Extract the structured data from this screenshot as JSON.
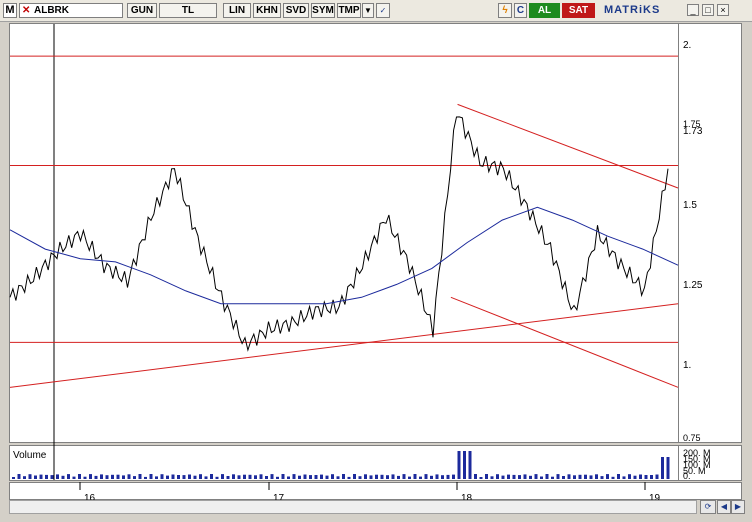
{
  "toolbar": {
    "logo": "M",
    "symbol": "ALBRK",
    "buttons": [
      "GUN",
      "TL",
      "LIN",
      "KHN",
      "SVD",
      "SYM",
      "TMP"
    ],
    "refresh_label": "C",
    "buy_label": "AL",
    "sell_label": "SAT",
    "brand": "MATRiKS",
    "window_buttons": [
      "_",
      "□",
      "×"
    ]
  },
  "colors": {
    "price_line": "#000000",
    "moving_average": "#1c2a9c",
    "trend_lines": "#d42020",
    "volume_bars": "#1c2a9c",
    "buy": "#1e8b1e",
    "sell": "#c01818"
  },
  "chart": {
    "y_ticks": [
      "2.",
      "1.75",
      "1.73",
      "1.5",
      "1.25",
      "1.",
      "0.75"
    ],
    "x_ticks": [
      "16",
      "17",
      "18",
      "19"
    ],
    "volume_label": "Volume",
    "volume_ticks": [
      "200. M",
      "150. M",
      "100. M",
      "50. M",
      "0."
    ]
  },
  "chart_data": {
    "type": "line",
    "title": "",
    "ylim": [
      0.75,
      2.05
    ],
    "x_categories": [
      "16",
      "17",
      "18",
      "19"
    ],
    "last_price": 1.73,
    "horizontal_levels": [
      1.95,
      1.61,
      1.06
    ],
    "series": [
      {
        "values": [
          1.2,
          1.26,
          1.34,
          1.4,
          1.3,
          1.25,
          1.45,
          1.6,
          1.38,
          1.2,
          1.05,
          1.1,
          1.12,
          1.16,
          1.17,
          1.3,
          1.45,
          1.3,
          1.1,
          1.78,
          1.62,
          1.6,
          1.48,
          1.35,
          1.15,
          1.4,
          1.3,
          1.22,
          1.6
        ]
      },
      {
        "values": [
          1.41,
          1.35,
          1.32,
          1.31,
          1.27,
          1.22,
          1.18,
          1.18,
          1.18,
          1.18,
          1.2,
          1.24,
          1.29,
          1.37,
          1.44,
          1.48,
          1.44,
          1.39,
          1.35,
          1.3
        ]
      }
    ]
  }
}
